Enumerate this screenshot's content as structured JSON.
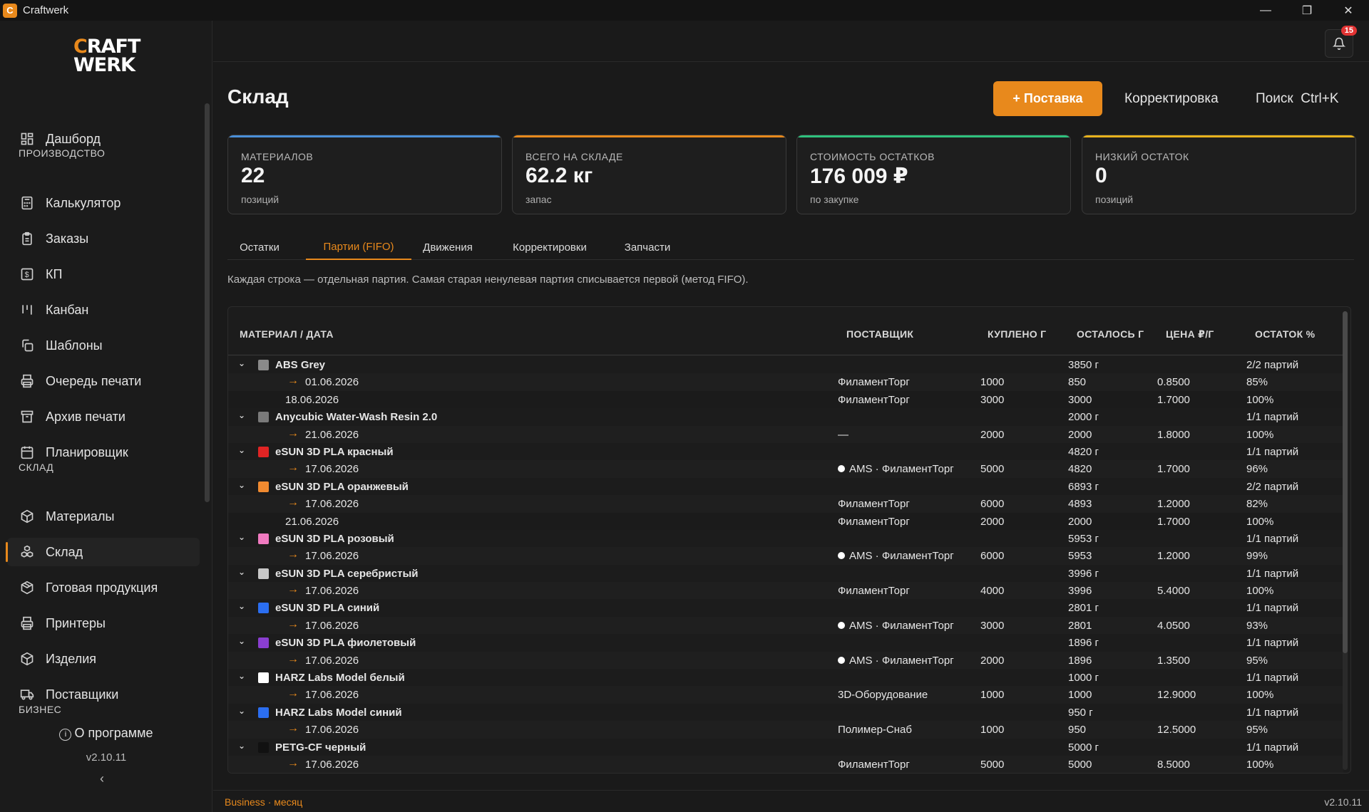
{
  "window": {
    "title": "Craftwerk",
    "app_icon": "C"
  },
  "logo": {
    "line1_a": "C",
    "line1_b": "RAFT",
    "line2": "WERK"
  },
  "sidebar": {
    "items": [
      {
        "label": "Дашборд",
        "icon": "dashboard-icon"
      },
      {
        "label": "Калькулятор",
        "icon": "calculator-icon"
      },
      {
        "label": "Заказы",
        "icon": "clipboard-icon"
      },
      {
        "label": "КП",
        "icon": "dollar-icon"
      },
      {
        "label": "Канбан",
        "icon": "kanban-icon"
      },
      {
        "label": "Шаблоны",
        "icon": "copy-icon"
      },
      {
        "label": "Очередь печати",
        "icon": "printer-icon"
      },
      {
        "label": "Архив печати",
        "icon": "archive-icon"
      },
      {
        "label": "Планировщик",
        "icon": "calendar-icon"
      },
      {
        "label": "Материалы",
        "icon": "box-icon"
      },
      {
        "label": "Склад",
        "icon": "boxes-icon"
      },
      {
        "label": "Готовая продукция",
        "icon": "package-icon"
      },
      {
        "label": "Принтеры",
        "icon": "printer-icon"
      },
      {
        "label": "Изделия",
        "icon": "box-icon"
      },
      {
        "label": "Поставщики",
        "icon": "truck-icon"
      }
    ],
    "sections": {
      "production": "ПРОИЗВОДСТВО",
      "warehouse": "СКЛАД",
      "business": "БИЗНЕС"
    },
    "about": "О программе",
    "version": "v2.10.11",
    "collapse": "‹"
  },
  "topbar": {
    "notifications": "15"
  },
  "page": {
    "title": "Склад",
    "btn_supply": "+ Поставка",
    "btn_adjust": "Корректировка",
    "search_label": "Поиск",
    "search_shortcut": "Ctrl+K"
  },
  "cards": [
    {
      "label": "МАТЕРИАЛОВ",
      "value": "22",
      "sub": "позиций",
      "color": "#4a8fd8"
    },
    {
      "label": "ВСЕГО НА СКЛАДЕ",
      "value": "62.2 кг",
      "sub": "запас",
      "color": "#e8891c"
    },
    {
      "label": "СТОИМОСТЬ ОСТАТКОВ",
      "value": "176 009 ₽",
      "sub": "по закупке",
      "color": "#2ec27e"
    },
    {
      "label": "НИЗКИЙ ОСТАТОК",
      "value": "0",
      "sub": "позиций",
      "color": "#e8b21c"
    }
  ],
  "tabs": [
    "Остатки",
    "Партии (FIFO)",
    "Движения",
    "Корректировки",
    "Запчасти"
  ],
  "hint": "Каждая строка — отдельная партия. Самая старая ненулевая партия списывается первой (метод FIFO).",
  "table": {
    "headers": [
      "МАТЕРИАЛ / ДАТА",
      "ПОСТАВЩИК",
      "КУПЛЕНО Г",
      "ОСТАЛОСЬ Г",
      "ЦЕНА ₽/Г",
      "ОСТАТОК %"
    ],
    "rows": [
      {
        "t": "g",
        "name": "ABS Grey",
        "color": "#8a8a8a",
        "left": "3850 г",
        "parts": "2/2 партий"
      },
      {
        "t": "b",
        "arrow": true,
        "date": "01.06.2026",
        "supplier": "ФиламентТорг",
        "bought": "1000",
        "left": "850",
        "price": "0.8500",
        "pct": "85%"
      },
      {
        "t": "b",
        "arrow": false,
        "date": "18.06.2026",
        "supplier": "ФиламентТорг",
        "bought": "3000",
        "left": "3000",
        "price": "1.7000",
        "pct": "100%"
      },
      {
        "t": "g",
        "name": "Anycubic Water-Wash Resin 2.0",
        "color": "#7a7a7a",
        "left": "2000 г",
        "parts": "1/1 партий"
      },
      {
        "t": "b",
        "arrow": true,
        "date": "21.06.2026",
        "supplier": "—",
        "bought": "2000",
        "left": "2000",
        "price": "1.8000",
        "pct": "100%"
      },
      {
        "t": "g",
        "name": "eSUN 3D PLA красный",
        "color": "#e02424",
        "left": "4820 г",
        "parts": "1/1 партий"
      },
      {
        "t": "b",
        "arrow": true,
        "date": "17.06.2026",
        "supplier": "AMS · ФиламентТорг",
        "ams": true,
        "bought": "5000",
        "left": "4820",
        "price": "1.7000",
        "pct": "96%"
      },
      {
        "t": "g",
        "name": "eSUN 3D PLA оранжевый",
        "color": "#f08a30",
        "left": "6893 г",
        "parts": "2/2 партий"
      },
      {
        "t": "b",
        "arrow": true,
        "date": "17.06.2026",
        "supplier": "ФиламентТорг",
        "bought": "6000",
        "left": "4893",
        "price": "1.2000",
        "pct": "82%"
      },
      {
        "t": "b",
        "arrow": false,
        "date": "21.06.2026",
        "supplier": "ФиламентТорг",
        "bought": "2000",
        "left": "2000",
        "price": "1.7000",
        "pct": "100%"
      },
      {
        "t": "g",
        "name": "eSUN 3D PLA розовый",
        "color": "#f07ac0",
        "left": "5953 г",
        "parts": "1/1 партий"
      },
      {
        "t": "b",
        "arrow": true,
        "date": "17.06.2026",
        "supplier": "AMS · ФиламентТорг",
        "ams": true,
        "bought": "6000",
        "left": "5953",
        "price": "1.2000",
        "pct": "99%"
      },
      {
        "t": "g",
        "name": "eSUN 3D PLA серебристый",
        "color": "#c8c8c8",
        "left": "3996 г",
        "parts": "1/1 партий"
      },
      {
        "t": "b",
        "arrow": true,
        "date": "17.06.2026",
        "supplier": "ФиламентТорг",
        "bought": "4000",
        "left": "3996",
        "price": "5.4000",
        "pct": "100%"
      },
      {
        "t": "g",
        "name": "eSUN 3D PLA синий",
        "color": "#2b6ef0",
        "left": "2801 г",
        "parts": "1/1 партий"
      },
      {
        "t": "b",
        "arrow": true,
        "date": "17.06.2026",
        "supplier": "AMS · ФиламентТорг",
        "ams": true,
        "bought": "3000",
        "left": "2801",
        "price": "4.0500",
        "pct": "93%"
      },
      {
        "t": "g",
        "name": "eSUN 3D PLA фиолетовый",
        "color": "#8a3ed0",
        "left": "1896 г",
        "parts": "1/1 партий"
      },
      {
        "t": "b",
        "arrow": true,
        "date": "17.06.2026",
        "supplier": "AMS · ФиламентТорг",
        "ams": true,
        "bought": "2000",
        "left": "1896",
        "price": "1.3500",
        "pct": "95%"
      },
      {
        "t": "g",
        "name": "HARZ Labs Model белый",
        "color": "#ffffff",
        "left": "1000 г",
        "parts": "1/1 партий"
      },
      {
        "t": "b",
        "arrow": true,
        "date": "17.06.2026",
        "supplier": "3D-Оборудование",
        "bought": "1000",
        "left": "1000",
        "price": "12.9000",
        "pct": "100%"
      },
      {
        "t": "g",
        "name": "HARZ Labs Model синий",
        "color": "#2b6ef0",
        "left": "950 г",
        "parts": "1/1 партий"
      },
      {
        "t": "b",
        "arrow": true,
        "date": "17.06.2026",
        "supplier": "Полимер-Снаб",
        "bought": "1000",
        "left": "950",
        "price": "12.5000",
        "pct": "95%"
      },
      {
        "t": "g",
        "name": "PETG-CF черный",
        "color": "#111111",
        "left": "5000 г",
        "parts": "1/1 партий"
      },
      {
        "t": "b",
        "arrow": true,
        "date": "17.06.2026",
        "supplier": "ФиламентТорг",
        "bought": "5000",
        "left": "5000",
        "price": "8.5000",
        "pct": "100%"
      }
    ]
  },
  "footer": {
    "plan": "Business · месяц",
    "version": "v2.10.11"
  },
  "colors": {
    "accent": "#e8891c",
    "background": "#1a1a1a"
  }
}
